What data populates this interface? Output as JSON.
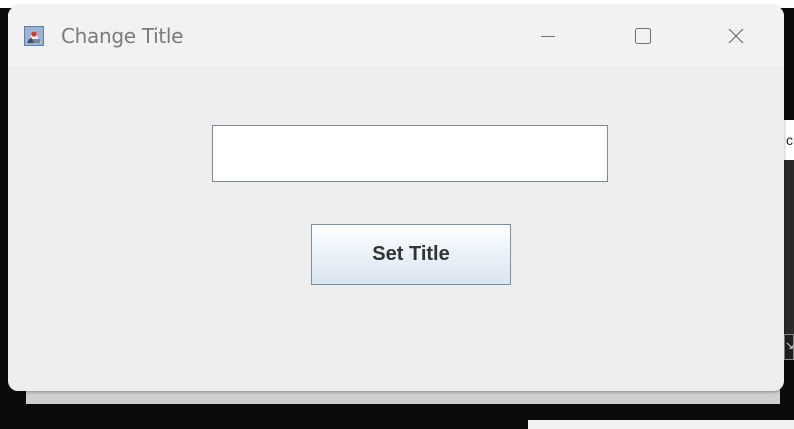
{
  "window": {
    "title": "Change Title",
    "controls": {
      "minimize_icon": "minimize-icon",
      "maximize_icon": "maximize-icon",
      "close_icon": "close-icon"
    }
  },
  "form": {
    "input_value": "",
    "input_placeholder": "",
    "button_label": "Set Title"
  },
  "background": {
    "edge_letter": "c",
    "edge_chip": "↘"
  },
  "colors": {
    "window_bg": "#eeeeee",
    "title_text": "#7b7b7b",
    "button_border": "#7a8ea5",
    "input_border": "#7a8a9a"
  }
}
